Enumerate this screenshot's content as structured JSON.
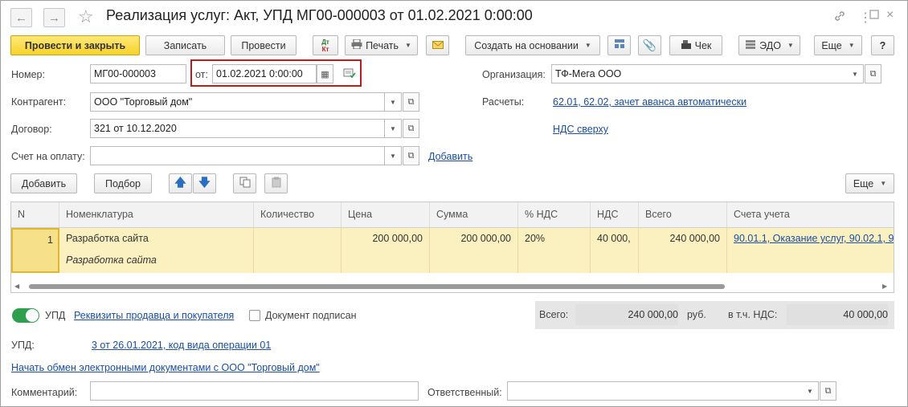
{
  "window": {
    "title": "Реализация услуг: Акт, УПД МГ00-000003 от 01.02.2021 0:00:00"
  },
  "icons": {
    "back": "arrow-left-icon",
    "forward": "arrow-right-icon",
    "favorite": "star-icon",
    "link": "link-icon",
    "menu": "more-vertical-icon",
    "maximize": "maximize-icon",
    "close": "close-icon"
  },
  "toolbar": {
    "post_close": "Провести и закрыть",
    "save": "Записать",
    "post": "Провести",
    "dtkt_top": "Дт",
    "dtkt_bottom": "Кт",
    "print": "Печать",
    "create_based": "Создать на основании",
    "receipt": "Чек",
    "edo": "ЭДО",
    "more": "Еще",
    "help": "?"
  },
  "header": {
    "number_label": "Номер:",
    "number_value": "МГ00-000003",
    "date_label": "от:",
    "date_value": "01.02.2021  0:00:00",
    "org_label": "Организация:",
    "org_value": "ТФ-Мега ООО",
    "counterparty_label": "Контрагент:",
    "counterparty_value": "ООО \"Торговый дом\"",
    "settlements_label": "Расчеты:",
    "settlements_link": "62.01, 62.02, зачет аванса автоматически",
    "contract_label": "Договор:",
    "contract_value": "321 от 10.12.2020",
    "vat_link": "НДС сверху",
    "invoice_label": "Счет на оплату:",
    "invoice_value": "",
    "invoice_add": "Добавить"
  },
  "table_toolbar": {
    "add": "Добавить",
    "pick": "Подбор",
    "more": "Еще"
  },
  "table": {
    "columns": [
      "N",
      "Номенклатура",
      "Количество",
      "Цена",
      "Сумма",
      "% НДС",
      "НДС",
      "Всего",
      "Счета учета"
    ],
    "row": {
      "n": "1",
      "item": "Разработка сайта",
      "item_content": "Разработка сайта",
      "qty": "",
      "price": "200 000,00",
      "sum": "200 000,00",
      "vat_rate": "20%",
      "vat": "40 000,",
      "total": "240 000,00",
      "accounts": "90.01.1, Оказание услуг, 90.02.1, 9"
    }
  },
  "footer": {
    "upd_toggle": "УПД",
    "requisites_link": "Реквизиты продавца и покупателя",
    "signed_label": "Документ подписан",
    "total_label": "Всего:",
    "total_value": "240 000,00",
    "currency": "руб.",
    "vat_label": "в т.ч. НДС:",
    "vat_value": "40 000,00",
    "upd_label": "УПД:",
    "upd_link": "3 от 26.01.2021, код вида операции 01",
    "edo_link": "Начать обмен электронными документами с ООО \"Торговый дом\"",
    "comment_label": "Комментарий:",
    "comment_value": "",
    "responsible_label": "Ответственный:",
    "responsible_value": ""
  },
  "colors": {
    "primary_button": "#f7d22b",
    "link": "#1a4ea2",
    "row_highlight": "#fbf0c0",
    "toggle_on": "#2e9e4f",
    "highlight_border": "#b02020"
  }
}
